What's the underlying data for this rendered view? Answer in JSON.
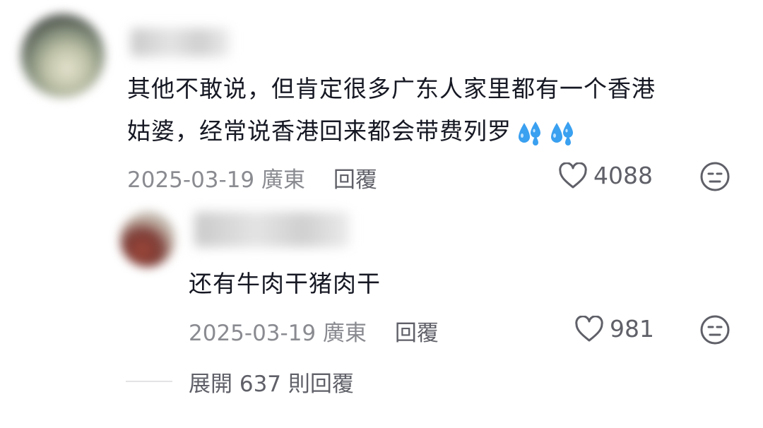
{
  "comment": {
    "line1": "其他不敢说，但肯定很多广东人家里都有一个香港",
    "line2": "姑婆，经常说香港回来都会带费列罗",
    "emoji_icon": "sweat-droplets-icon",
    "date": "2025-03-19",
    "region": "廣東",
    "reply_label": "回覆",
    "likes": "4088"
  },
  "reply": {
    "text": "还有牛肉干猪肉干",
    "date": "2025-03-19",
    "region": "廣東",
    "reply_label": "回覆",
    "likes": "981"
  },
  "expand": {
    "label": "展開 637 則回覆"
  },
  "colors": {
    "text": "#161823",
    "meta": "#8a8b91",
    "secondary": "#5f6068",
    "emoji": "#3aa0f0"
  }
}
